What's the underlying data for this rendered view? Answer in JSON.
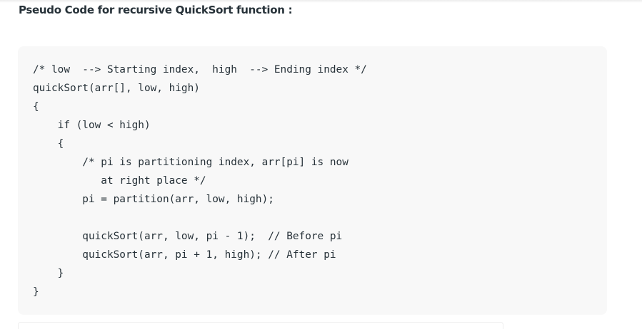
{
  "heading": "Pseudo Code for recursive QuickSort function :",
  "code_lines": [
    "/* low  --> Starting index,  high  --> Ending index */",
    "quickSort(arr[], low, high)",
    "{",
    "    if (low < high)",
    "    {",
    "        /* pi is partitioning index, arr[pi] is now",
    "           at right place */",
    "        pi = partition(arr, low, high);",
    "",
    "        quickSort(arr, low, pi - 1);  // Before pi",
    "        quickSort(arr, pi + 1, high); // After pi",
    "    }",
    "}"
  ]
}
